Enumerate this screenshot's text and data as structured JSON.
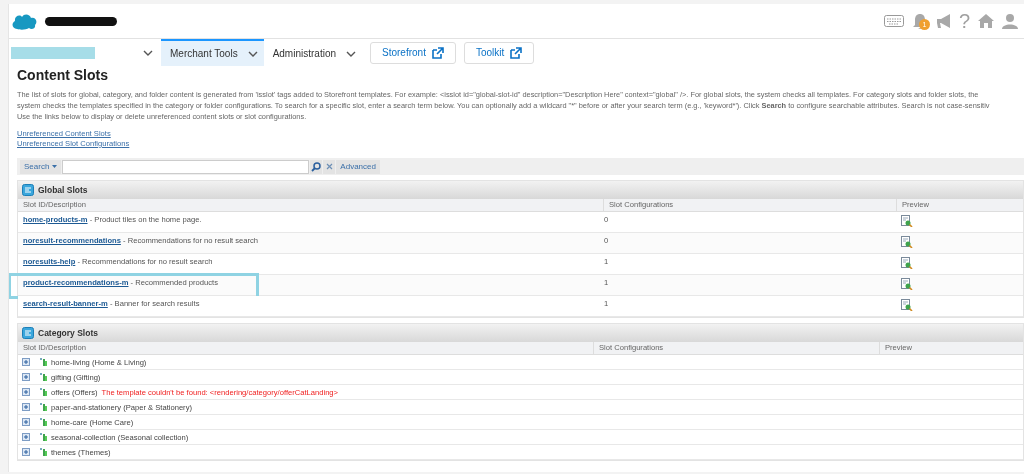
{
  "header": {
    "notification_count": "1",
    "help_glyph": "?"
  },
  "nav": {
    "menus": [
      {
        "label": "Merchant Tools",
        "selected": true
      },
      {
        "label": "Administration",
        "selected": false
      }
    ],
    "buttons": [
      "Storefront",
      "Toolkit"
    ]
  },
  "page": {
    "title": "Content Slots",
    "description_lines": [
      "The list of slots for global, category, and folder content is generated from 'isslot' tags added to Storefront templates. For example: <isslot id=\"global-slot-id\" description=\"Description Here\" context=\"global\" />. For global slots, the system checks all templates. For category slots and folder slots, the",
      [
        {
          "text": "system checks the templates specified in the category or folder configurations. To search for a specific slot, enter a search term below. You can optionally add a wildcard \"*\" before or after your search term (e.g., 'keyword*'). Click ",
          "bold": false
        },
        {
          "text": "Search",
          "bold": true
        },
        {
          "text": " to configure searchable attributes. Search is not case-sensitiv",
          "bold": false
        }
      ],
      "Use the links below to display or delete unreferenced content slots or slot configurations."
    ],
    "links": [
      "Unreferenced Content Slots",
      "Unreferenced Slot Configurations"
    ]
  },
  "search": {
    "label": "Search",
    "button": "Advanced"
  },
  "global_slots": {
    "title": "Global Slots",
    "columns": [
      "Slot ID/Description",
      "Slot Configurations",
      "Preview"
    ],
    "rows": [
      {
        "id": "home-products-m",
        "description": "- Product tiles on the home page.",
        "configurations": "0",
        "highlighted": false
      },
      {
        "id": "noresult-recommendations",
        "description": "- Recommendations for no result search",
        "configurations": "0",
        "highlighted": false
      },
      {
        "id": "noresults-help",
        "description": "- Recommendations for no result search",
        "configurations": "1",
        "highlighted": false
      },
      {
        "id": "product-recommendations-m",
        "description": "- Recommended products",
        "configurations": "1",
        "highlighted": true
      },
      {
        "id": "search-result-banner-m",
        "description": "- Banner for search results",
        "configurations": "1",
        "highlighted": false
      }
    ]
  },
  "category_slots": {
    "title": "Category Slots",
    "columns": [
      "Slot ID/Description",
      "Slot Configurations",
      "Preview"
    ],
    "rows": [
      {
        "name": "home-living (Home & Living)"
      },
      {
        "name": "gifting (Gifting)"
      },
      {
        "name": "offers (Offers)",
        "error": "The template couldn't be found: <rendering/category/offerCatLanding>"
      },
      {
        "name": "paper-and-stationery (Paper & Stationery)"
      },
      {
        "name": "home-care (Home Care)"
      },
      {
        "name": "seasonal-collection (Seasonal collection)"
      },
      {
        "name": "themes (Themes)"
      }
    ]
  }
}
